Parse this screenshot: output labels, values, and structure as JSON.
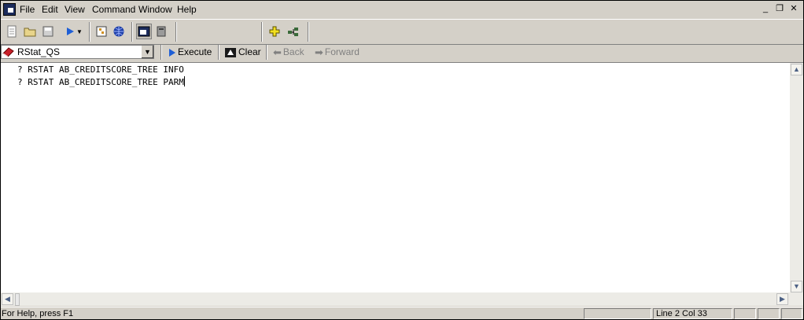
{
  "menu": {
    "items": [
      {
        "label": "File"
      },
      {
        "label": "Edit"
      },
      {
        "label": "View"
      },
      {
        "label": "Command"
      },
      {
        "label": "Window"
      },
      {
        "label": "Help"
      }
    ]
  },
  "mdi": {
    "minimize": "_",
    "restore": "❐",
    "close": "✕"
  },
  "toolbar2": {
    "server_combo": "RStat_QS",
    "execute_label": "Execute",
    "clear_label": "Clear",
    "back_label": "Back",
    "forward_label": "Forward"
  },
  "editor": {
    "lines": [
      "? RSTAT AB_CREDITSCORE_TREE INFO",
      "? RSTAT AB_CREDITSCORE_TREE PARM"
    ]
  },
  "status": {
    "help_text": "For Help, press F1",
    "position": "Line 2 Col 33"
  }
}
